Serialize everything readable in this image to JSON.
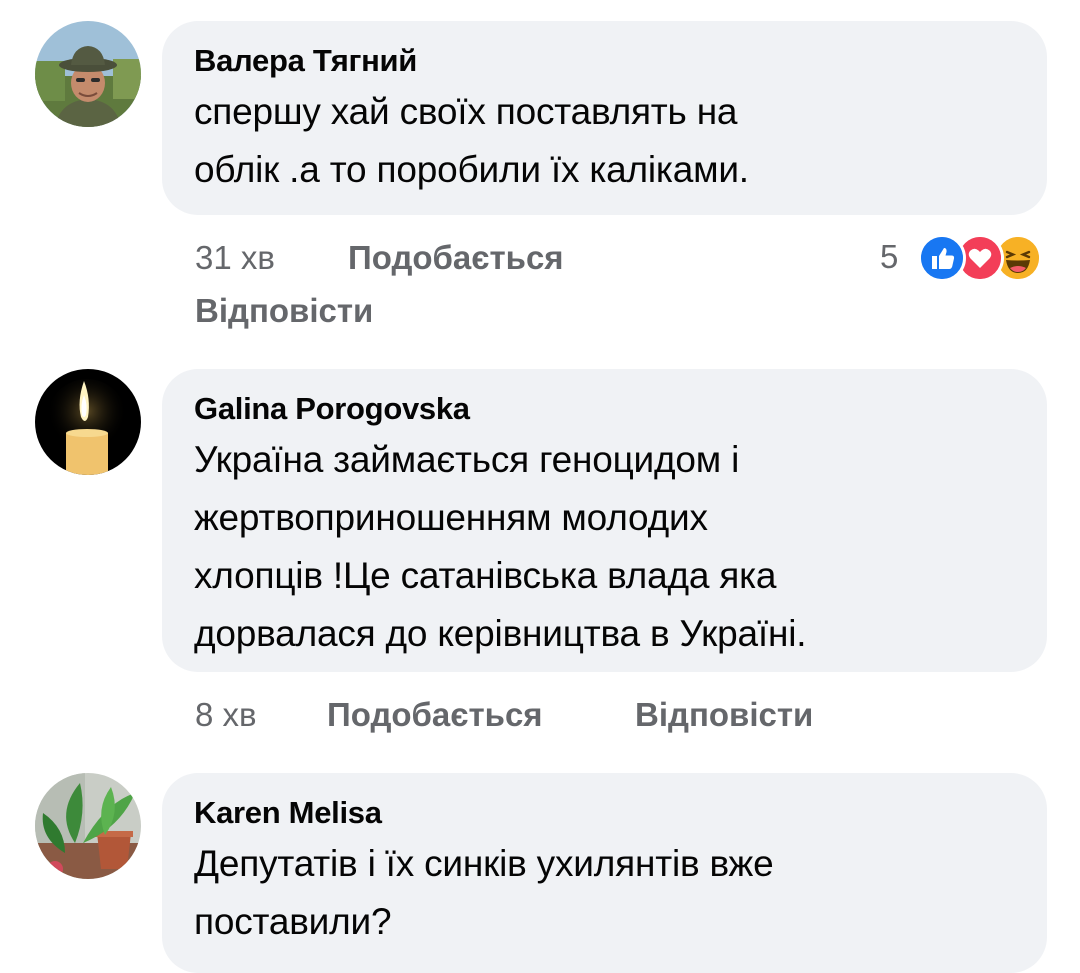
{
  "comments": [
    {
      "author": "Валера Тягний",
      "text": "спершу хай своїх поставлять на\nоблік .а то поробили їх каліками.",
      "time": "31 хв",
      "like_label": "Подобається",
      "reply_label": "Відповісти",
      "reaction_count": "5",
      "reactions": [
        "like-icon",
        "love-icon",
        "haha-icon"
      ],
      "avatar": "man-in-hat-avatar"
    },
    {
      "author": "Galina Porogovska",
      "text": "Україна займається геноцидом і\nжертвоприношенням молодих\nхлопців !Це сатанівська влада яка\nдорвалася до керівництва в Україні.",
      "time": "8 хв",
      "like_label": "Подобається",
      "reply_label": "Відповісти",
      "avatar": "candle-avatar"
    },
    {
      "author": "Karen Melisa",
      "text": "Депутатів і їх синків ухилянтів вже\nпоставили?",
      "avatar": "plant-avatar"
    }
  ],
  "colors": {
    "bubble": "#f0f2f5",
    "secondary_text": "#65676b",
    "like_blue": "#1877f2",
    "love_red": "#f33e58",
    "haha_yellow": "#f7b125"
  }
}
